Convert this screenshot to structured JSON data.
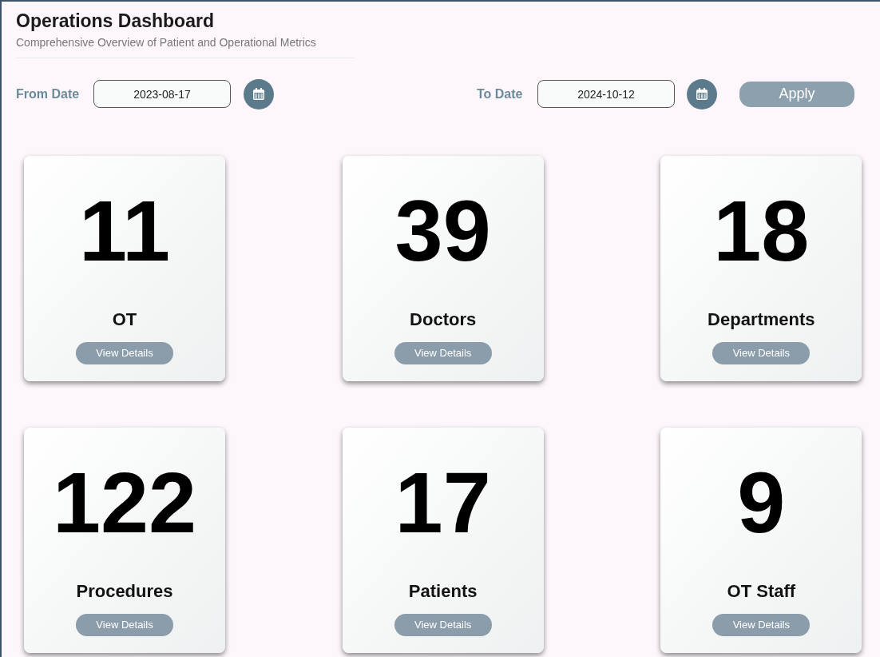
{
  "header": {
    "title": "Operations Dashboard",
    "subtitle": "Comprehensive Overview of Patient and Operational Metrics"
  },
  "filters": {
    "from": {
      "label": "From Date",
      "value": "2023-08-17"
    },
    "to": {
      "label": "To Date",
      "value": "2024-10-12"
    },
    "apply": "Apply"
  },
  "cards": [
    {
      "value": "11",
      "label": "OT",
      "button": "View Details"
    },
    {
      "value": "39",
      "label": "Doctors",
      "button": "View Details"
    },
    {
      "value": "18",
      "label": "Departments",
      "button": "View Details"
    },
    {
      "value": "122",
      "label": "Procedures",
      "button": "View Details"
    },
    {
      "value": "17",
      "label": "Patients",
      "button": "View Details"
    },
    {
      "value": "9",
      "label": "OT Staff",
      "button": "View Details"
    }
  ]
}
